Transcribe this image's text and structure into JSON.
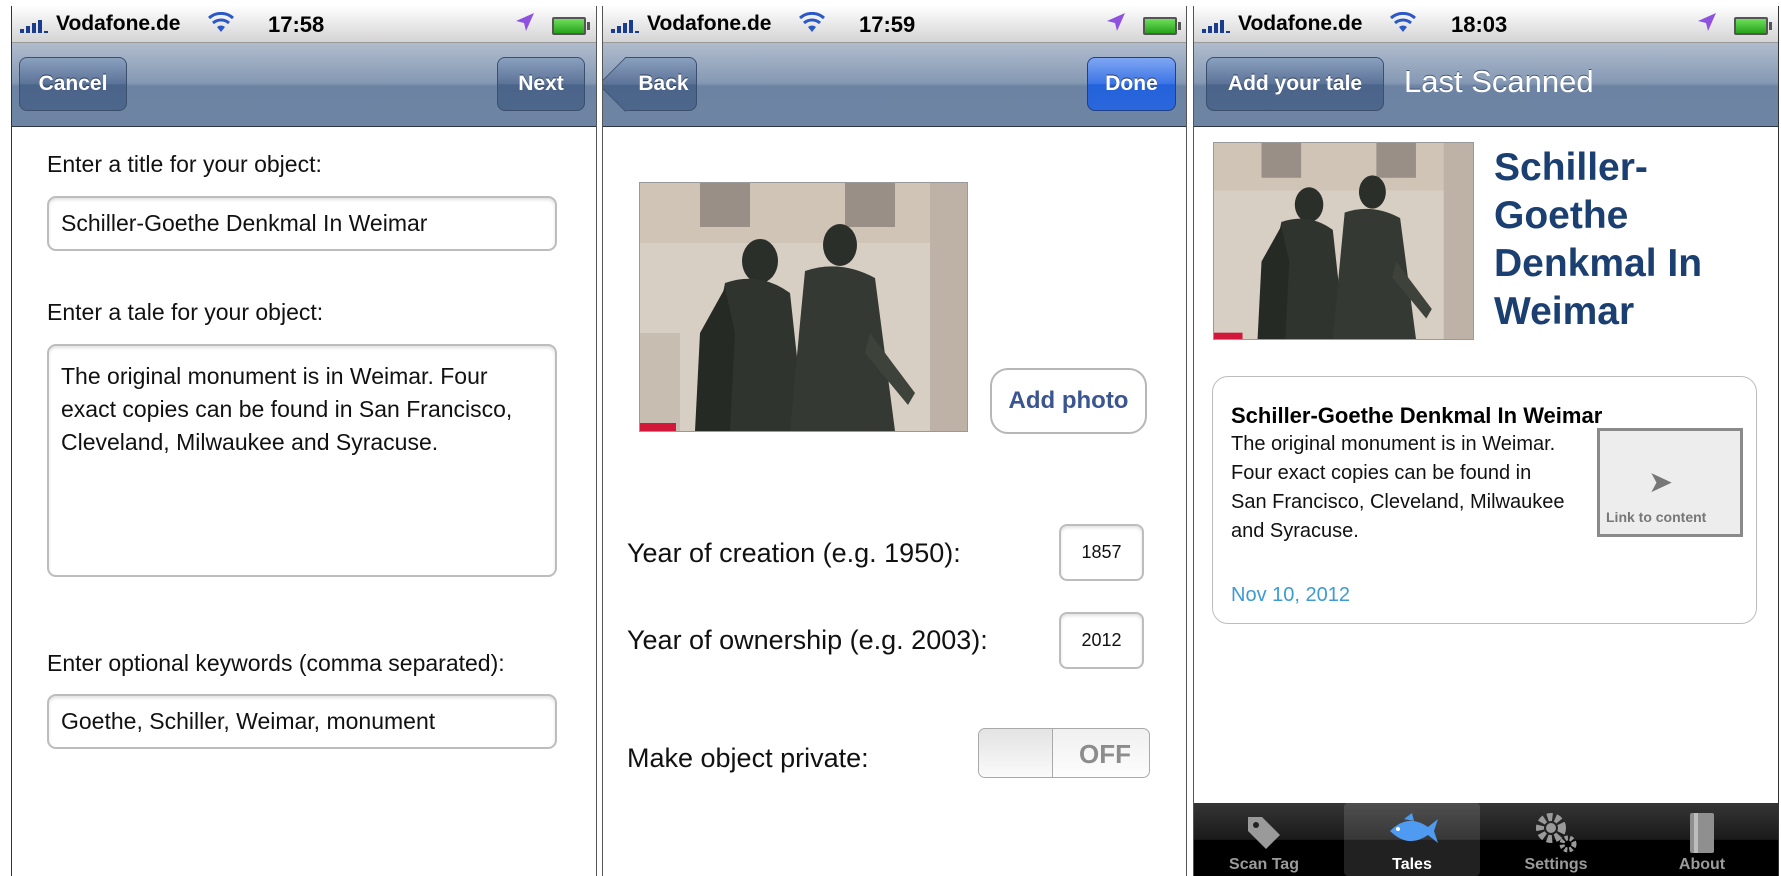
{
  "status_bars": [
    {
      "carrier": "Vodafone.de",
      "time": "17:58"
    },
    {
      "carrier": "Vodafone.de",
      "time": "17:59"
    },
    {
      "carrier": "Vodafone.de",
      "time": "18:03"
    }
  ],
  "screen1": {
    "cancel_label": "Cancel",
    "next_label": "Next",
    "title_prompt": "Enter a title for your object:",
    "title_value": "Schiller-Goethe Denkmal In Weimar",
    "tale_prompt": "Enter a tale for your object:",
    "tale_value": "The original monument is in Weimar. Four exact copies can be found in San Francisco, Cleveland, Milwaukee and Syracuse.",
    "keywords_prompt": "Enter optional keywords (comma separated):",
    "keywords_value": "Goethe, Schiller, Weimar, monument"
  },
  "screen2": {
    "back_label": "Back",
    "done_label": "Done",
    "add_photo_label": "Add photo",
    "creation_label": "Year of creation (e.g. 1950):",
    "creation_value": "1857",
    "ownership_label": "Year of ownership (e.g. 2003):",
    "ownership_value": "2012",
    "private_label": "Make object private:",
    "private_state": "OFF"
  },
  "screen3": {
    "add_tale_label": "Add your tale",
    "nav_title": "Last Scanned",
    "big_title": "Schiller-Goethe Denkmal In Weimar",
    "card_title": "Schiller-Goethe Denkmal In Weimar",
    "card_body": "The original monument is in Weimar. Four exact copies can be found in San Francisco, Cleveland, Milwaukee and Syracuse.",
    "card_date": "Nov 10, 2012",
    "link_label": "Link to content",
    "tabs": [
      {
        "label": "Scan Tag",
        "icon": "tag-icon",
        "active": false
      },
      {
        "label": "Tales",
        "icon": "fish-icon",
        "active": true
      },
      {
        "label": "Settings",
        "icon": "gears-icon",
        "active": false
      },
      {
        "label": "About",
        "icon": "book-icon",
        "active": false
      }
    ]
  },
  "colors": {
    "navbar": "#7b8fad",
    "done_button": "#2f6ae0",
    "title_blue": "#1a3f70",
    "date_blue": "#3d9bd3",
    "location_purple": "#8f52e0"
  }
}
